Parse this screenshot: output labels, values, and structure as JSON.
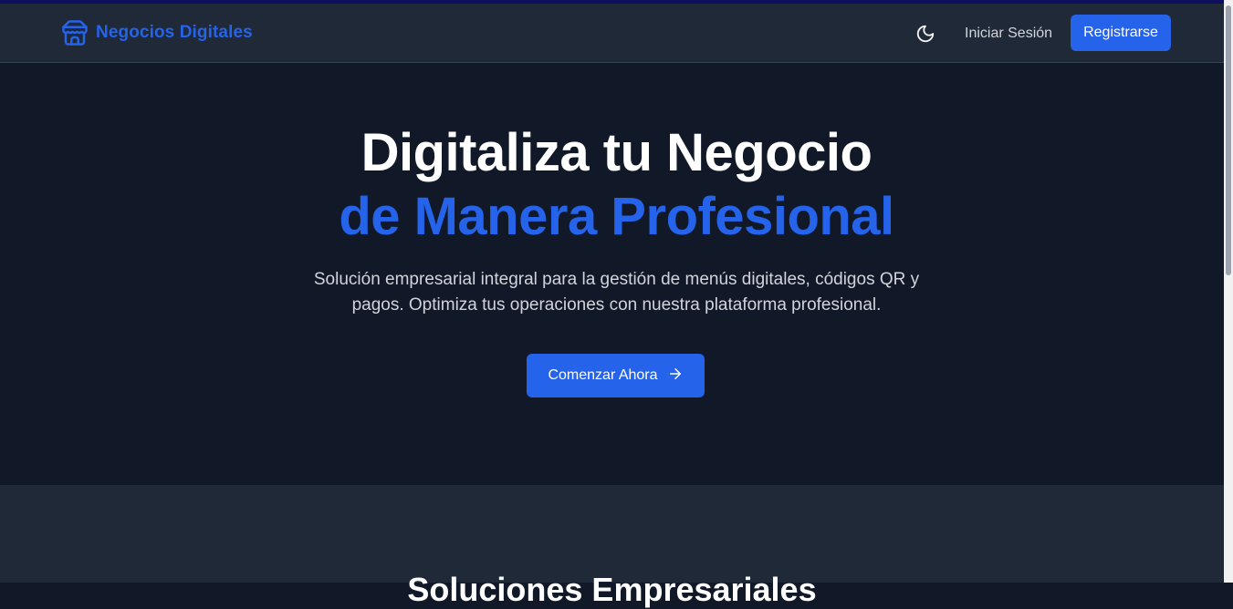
{
  "nav": {
    "brand": "Negocios Digitales",
    "login_label": "Iniciar Sesión",
    "register_label": "Registrarse"
  },
  "hero": {
    "title_line1": "Digitaliza tu Negocio",
    "title_line2": "de Manera Profesional",
    "subtitle": "Solución empresarial integral para la gestión de menús digitales, códigos QR y pagos. Optimiza tus operaciones con nuestra plataforma profesional.",
    "cta_label": "Comenzar Ahora"
  },
  "section2": {
    "heading": "Soluciones Empresariales"
  },
  "icons": {
    "brand": "store-icon",
    "theme": "moon-icon",
    "cta": "arrow-right-icon"
  },
  "colors": {
    "accent": "#2563eb",
    "page_bg": "#111827",
    "nav_bg": "#1f2937"
  }
}
